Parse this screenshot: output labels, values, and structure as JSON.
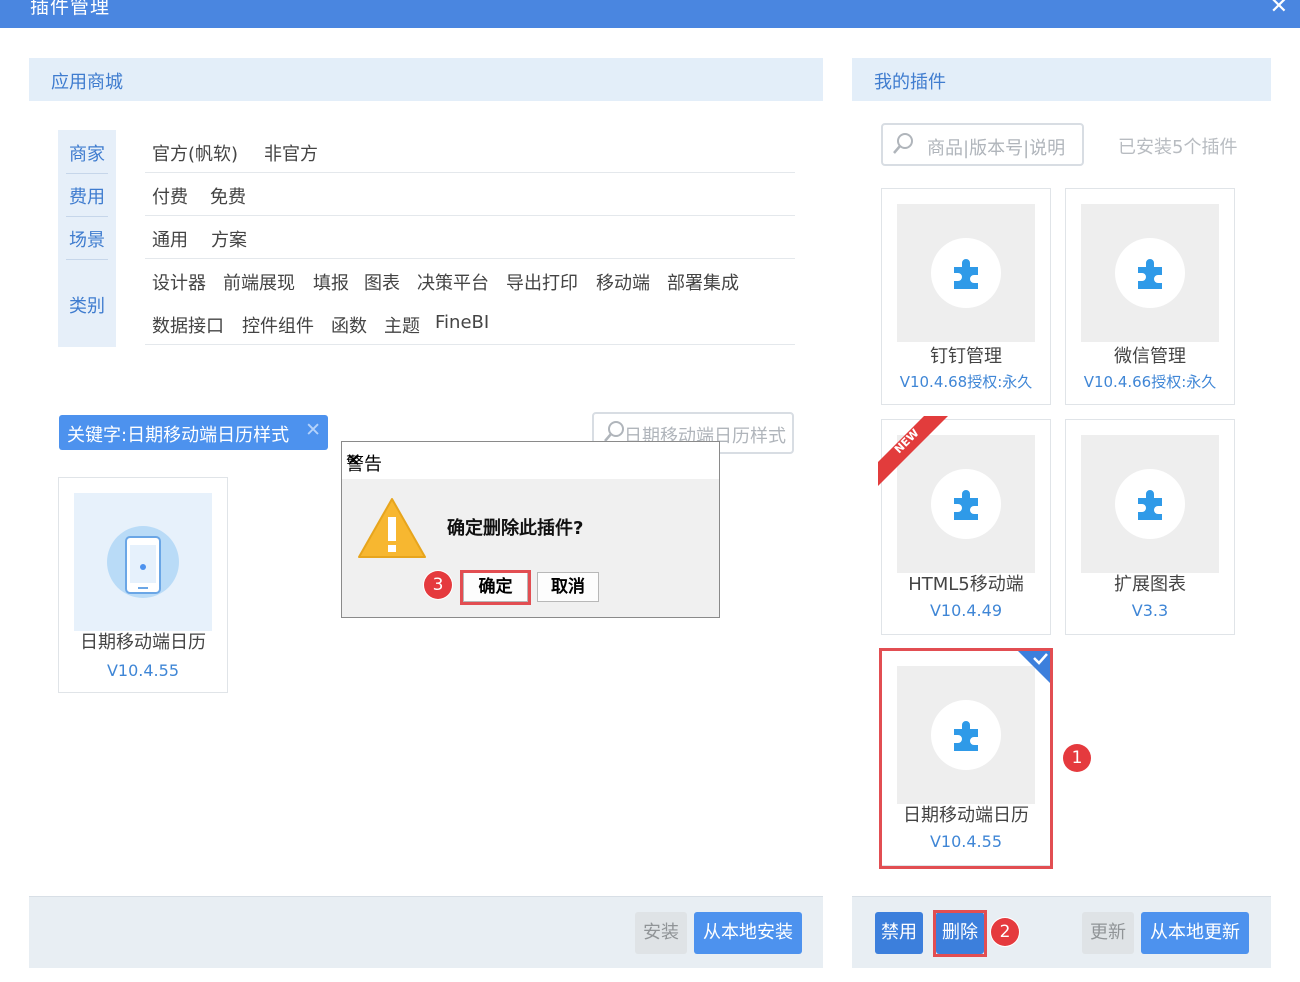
{
  "window": {
    "title": "插件管理",
    "close_glyph": "✕"
  },
  "store": {
    "header": "应用商城",
    "filter_labels": [
      "商家",
      "费用",
      "场景",
      "类别"
    ],
    "filters": {
      "merchant": [
        "官方(帆软)",
        "非官方"
      ],
      "fee": [
        "付费",
        "免费"
      ],
      "scene": [
        "通用",
        "方案"
      ],
      "category_row1": [
        "设计器",
        "前端展现",
        "填报",
        "图表",
        "决策平台",
        "导出打印",
        "移动端",
        "部署集成"
      ],
      "category_row2": [
        "数据接口",
        "控件组件",
        "函数",
        "主题",
        "FineBI"
      ]
    },
    "keyword_tag": "关键字:日期移动端日历样式",
    "keyword_remove": "✕",
    "search_value": "日期移动端日历样式",
    "result": {
      "name": "日期移动端日历",
      "version": "V10.4.55"
    },
    "buttons": {
      "install": "安装",
      "install_local": "从本地安装"
    }
  },
  "my_plugins": {
    "header": "我的插件",
    "search_placeholder": "商品|版本号|说明",
    "installed_count": "已安装5个插件",
    "plugins": [
      {
        "name": "钉钉管理",
        "version": "V10.4.68授权:永久"
      },
      {
        "name": "微信管理",
        "version": "V10.4.66授权:永久"
      },
      {
        "name": "HTML5移动端",
        "version": "V10.4.49",
        "badge": "NEW"
      },
      {
        "name": "扩展图表",
        "version": "V3.3"
      },
      {
        "name": "日期移动端日历",
        "version": "V10.4.55",
        "selected": true
      }
    ],
    "buttons": {
      "disable": "禁用",
      "delete": "删除",
      "update": "更新",
      "update_local": "从本地更新"
    }
  },
  "dialog": {
    "title": "警告",
    "message": "确定删除此插件?",
    "ok": "确定",
    "cancel": "取消",
    "close_glyph": "✕"
  },
  "markers": {
    "m1": "1",
    "m2": "2",
    "m3": "3"
  },
  "colors": {
    "accent": "#4d92ee",
    "titlebar": "#4a86e0",
    "highlight": "#e24e52",
    "link": "#3f86d6"
  }
}
